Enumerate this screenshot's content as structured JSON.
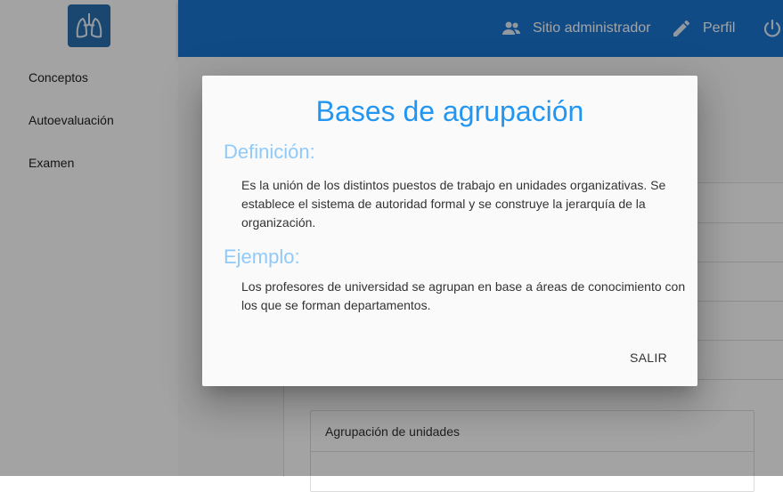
{
  "sidebar": {
    "items": [
      {
        "label": "Conceptos"
      },
      {
        "label": "Autoevaluación"
      },
      {
        "label": "Examen"
      }
    ]
  },
  "header": {
    "admin_label": "Sitio administrador",
    "profile_label": "Perfil"
  },
  "background": {
    "card_title": "Agrupación de unidades"
  },
  "dialog": {
    "title": "Bases de agrupación",
    "definition_heading": "Definición:",
    "definition_text": "Es la unión de los distintos puestos de trabajo en unidades organizativas. Se establece el sistema de autoridad formal y se construye la jerarquía de la organización.",
    "example_heading": "Ejemplo:",
    "example_text": "Los profesores de universidad se agrupan en base a áreas de conocimiento con los que se forman departamentos.",
    "exit_label": "SALIR"
  },
  "colors": {
    "appbar": "#1976d2",
    "dialog_title": "#2196f3",
    "section_heading": "#90caf9"
  }
}
